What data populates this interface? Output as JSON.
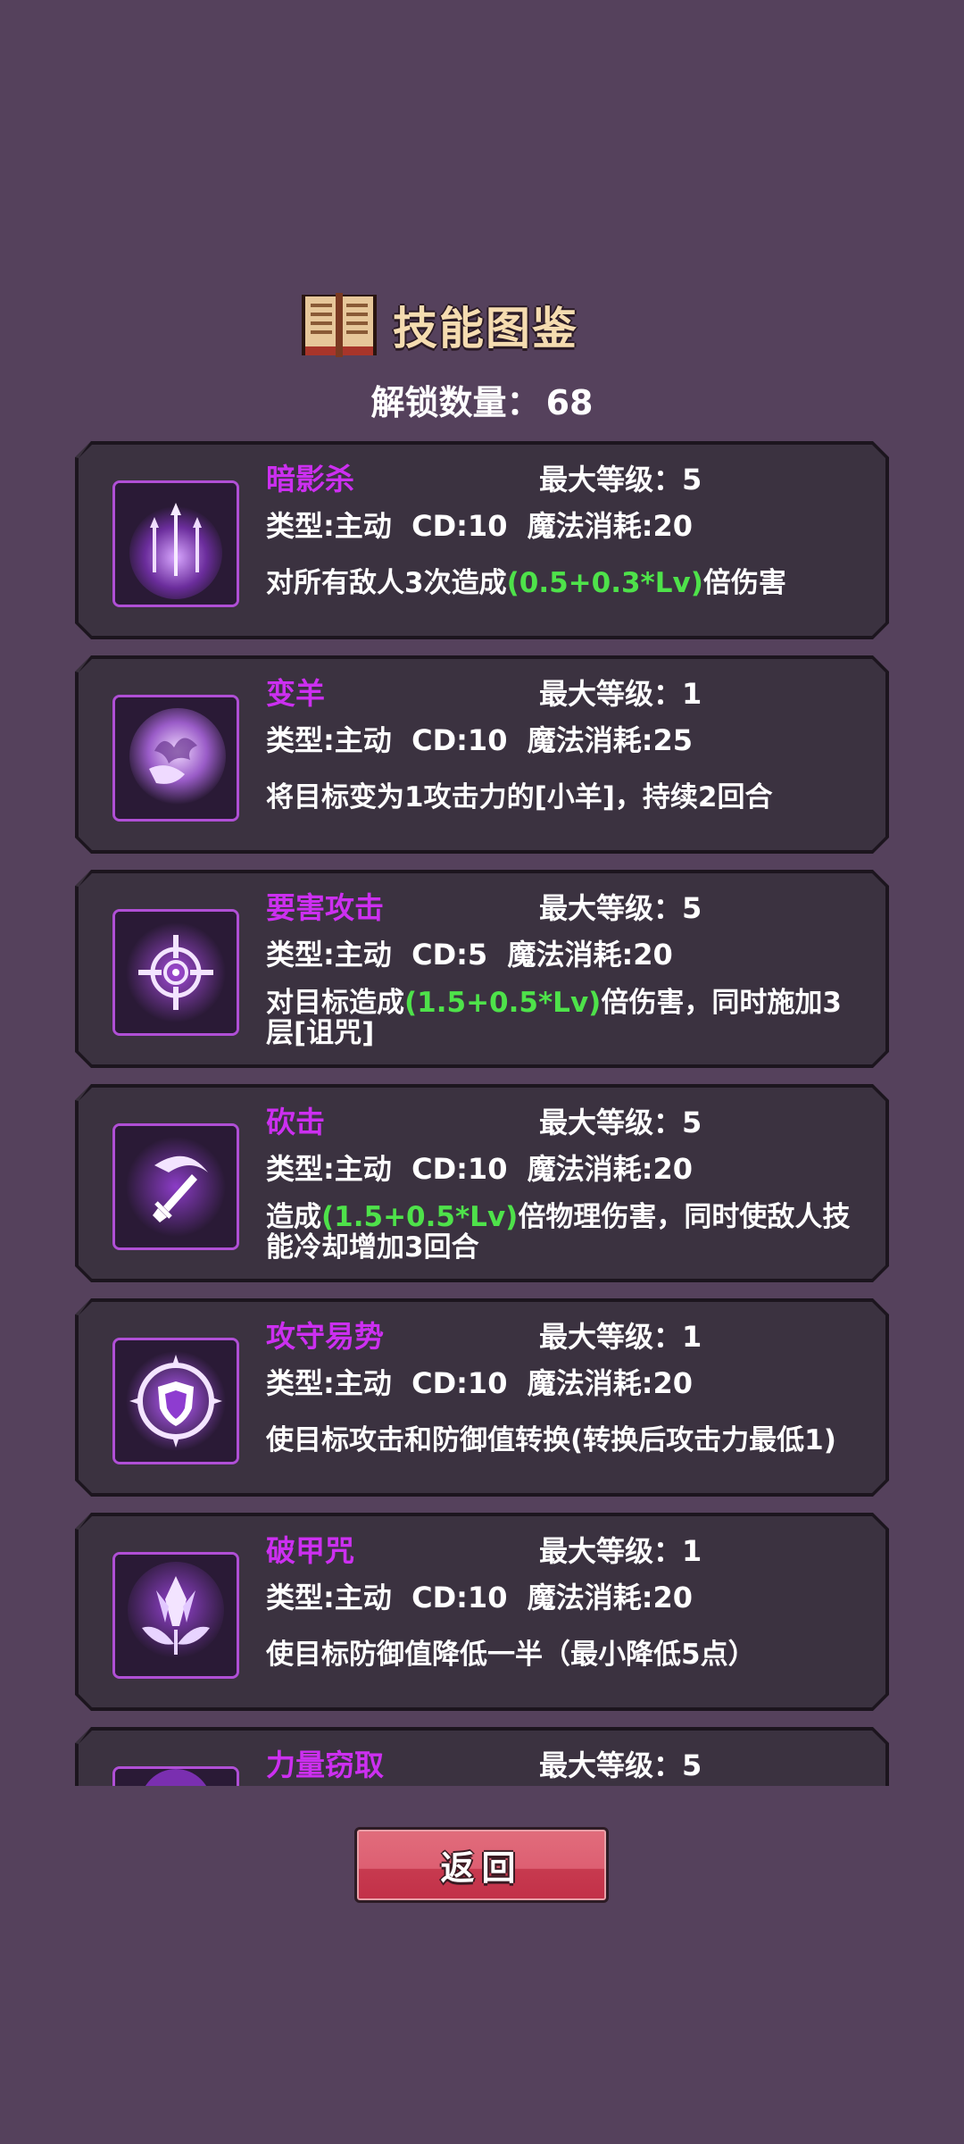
{
  "header": {
    "title": "技能图鉴",
    "book_icon": "open-book-icon"
  },
  "unlock": {
    "label": "解锁数量：",
    "count": "68"
  },
  "skills": [
    {
      "name": "暗影杀",
      "max_level": "最大等级：5",
      "stats": "类型:主动  CD:10  魔法消耗:20",
      "desc_pre": "对所有敌人3次造成",
      "desc_formula": "(0.5+0.3*Lv)",
      "desc_post": "倍伤害",
      "icon": "triple-arrow-icon"
    },
    {
      "name": "变羊",
      "max_level": "最大等级：1",
      "stats": "类型:主动  CD:10  魔法消耗:25",
      "desc_pre": "将目标变为1攻击力的[小羊]，持续2回合",
      "desc_formula": "",
      "desc_post": "",
      "icon": "sheep-orb-icon"
    },
    {
      "name": "要害攻击",
      "max_level": "最大等级：5",
      "stats": "类型:主动  CD:5  魔法消耗:20",
      "desc_pre": "对目标造成",
      "desc_formula": "(1.5+0.5*Lv)",
      "desc_post": "倍伤害，同时施加3层[诅咒]",
      "icon": "crosshair-icon"
    },
    {
      "name": "砍击",
      "max_level": "最大等级：5",
      "stats": "类型:主动  CD:10  魔法消耗:20",
      "desc_pre": "造成",
      "desc_formula": "(1.5+0.5*Lv)",
      "desc_post": "倍物理伤害，同时使敌人技能冷却增加3回合",
      "icon": "sword-slash-icon"
    },
    {
      "name": "攻守易势",
      "max_level": "最大等级：1",
      "stats": "类型:主动  CD:10  魔法消耗:20",
      "desc_pre": "使目标攻击和防御值转换(转换后攻击力最低1)",
      "desc_formula": "",
      "desc_post": "",
      "icon": "shield-burst-icon"
    },
    {
      "name": "破甲咒",
      "max_level": "最大等级：1",
      "stats": "类型:主动  CD:10  魔法消耗:20",
      "desc_pre": "使目标防御值降低一半（最小降低5点）",
      "desc_formula": "",
      "desc_post": "",
      "icon": "crystal-flower-icon"
    },
    {
      "name": "力量窃取",
      "max_level": "最大等级：5",
      "stats": "",
      "desc_pre": "",
      "desc_formula": "",
      "desc_post": "",
      "icon": "power-steal-icon"
    }
  ],
  "back_button": {
    "label": "返回"
  },
  "colors": {
    "background": "#55415c",
    "card": "#3b3240",
    "skill_name": "#cc2ff0",
    "formula": "#4ee24a",
    "button": "#dd5f72"
  }
}
